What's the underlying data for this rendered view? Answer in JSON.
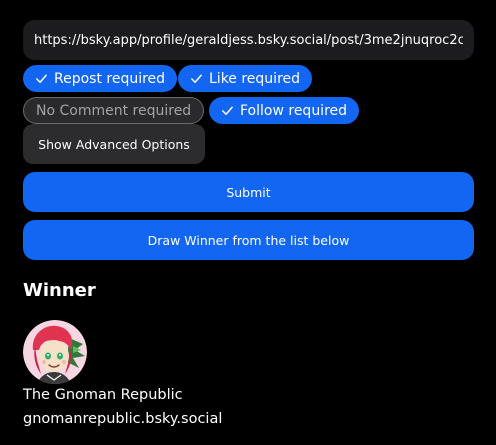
{
  "form": {
    "post_url": "https://bsky.app/profile/geraldjess.bsky.social/post/3me2jnuqroc2c"
  },
  "requirements": [
    {
      "label": "Repost required",
      "checked": true
    },
    {
      "label": "Like required",
      "checked": true
    },
    {
      "label": "No Comment required",
      "checked": false
    },
    {
      "label": "Follow required",
      "checked": true
    }
  ],
  "buttons": {
    "advanced": "Show Advanced Options",
    "submit": "Submit",
    "draw": "Draw Winner from the list below"
  },
  "winner": {
    "heading": "Winner",
    "display_name": "The Gnoman Republic",
    "handle": "gnomanrepublic.bsky.social"
  },
  "colors": {
    "accent": "#1266f1",
    "background": "#000000",
    "surface": "#1c1c1e"
  }
}
